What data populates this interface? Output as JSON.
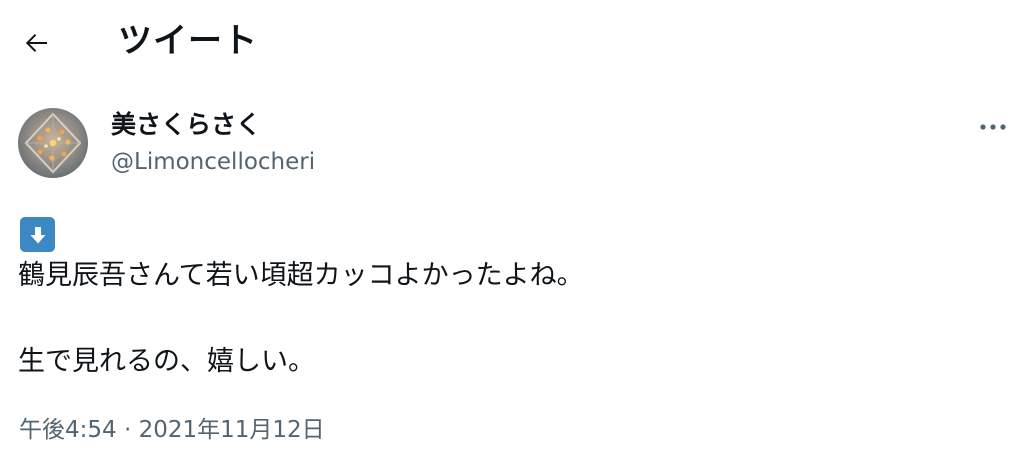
{
  "header": {
    "back_icon": "arrow-left-icon",
    "title": "ツイート"
  },
  "author": {
    "avatar_icon": "profile-photo-chandelier",
    "name": "美さくらさく",
    "handle": "@Limoncellocheri"
  },
  "more_icon": "more-horizontal-icon",
  "tweet": {
    "emoji_icon": "down-arrow-button-emoji",
    "lines": [
      "鶴見辰吾さんて若い頃超カッコよかったよね。",
      "生で見れるの、嬉しい。"
    ]
  },
  "timestamp": {
    "time": "午後4:54",
    "separator": "·",
    "date": "2021年11月12日"
  },
  "colors": {
    "text": "#0f1419",
    "secondary_text": "#536471",
    "emoji_blue": "#3b88c3",
    "background": "#ffffff"
  }
}
